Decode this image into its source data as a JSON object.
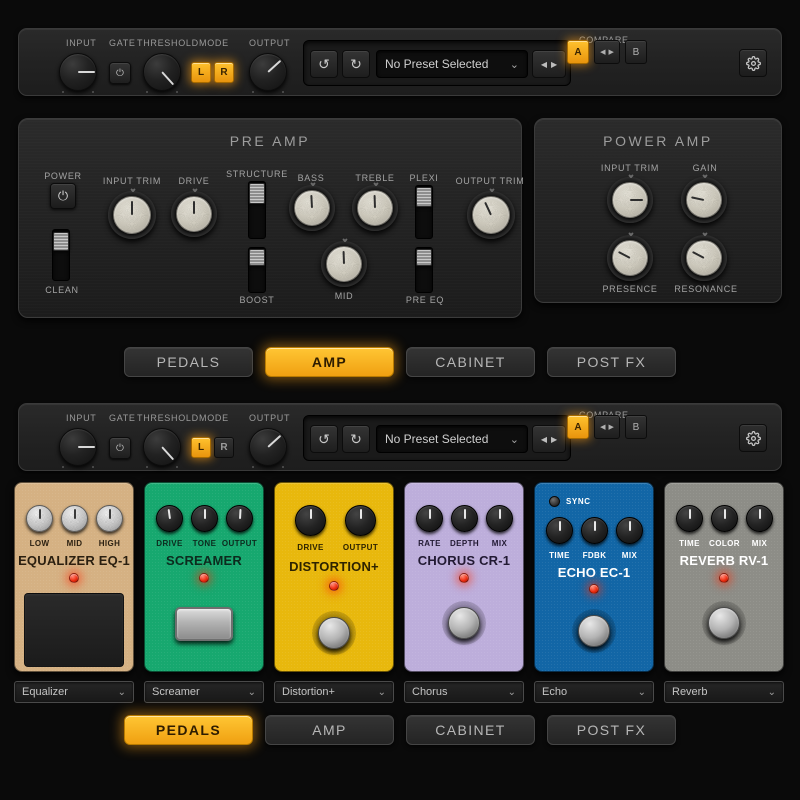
{
  "colors": {
    "accent": "#f0a011",
    "panel": "#242424",
    "background": "#0a0a0a",
    "led_red": "#ef2d10"
  },
  "toolbar_top": {
    "input_label": "INPUT",
    "gate_label": "GATE",
    "threshold_label": "THRESHOLD",
    "mode_label": "MODE",
    "output_label": "OUTPUT",
    "mode_l": "L",
    "mode_r": "R",
    "mode_l_active": true,
    "mode_r_active": true,
    "undo_icon": "undo-icon",
    "redo_icon": "redo-icon",
    "preset_value": "No Preset Selected",
    "preset_chevron": "⌄",
    "prev_icon": "◀",
    "next_icon": "▶",
    "compare_label": "COMPARE",
    "compare_a": "A",
    "compare_b": "B",
    "compare_a_active": true,
    "settings_icon": "gear-icon"
  },
  "toolbar_bottom": {
    "input_label": "INPUT",
    "gate_label": "GATE",
    "threshold_label": "THRESHOLD",
    "mode_label": "MODE",
    "output_label": "OUTPUT",
    "mode_l": "L",
    "mode_r": "R",
    "mode_l_active": true,
    "mode_r_active": false,
    "preset_value": "No Preset Selected",
    "preset_chevron": "⌄",
    "prev_icon": "◀",
    "next_icon": "▶",
    "compare_label": "COMPARE",
    "compare_a": "A",
    "compare_b": "B",
    "settings_icon": "gear-icon"
  },
  "pre_amp": {
    "title": "PRE AMP",
    "power_label": "POWER",
    "power_icon": "⏻",
    "clean_label": "CLEAN",
    "input_trim_label": "INPUT TRIM",
    "drive_label": "DRIVE",
    "structure_label": "STRUCTURE",
    "boost_label": "BOOST",
    "bass_label": "BASS",
    "treble_label": "TREBLE",
    "mid_label": "MID",
    "plexi_label": "PLEXI",
    "pre_eq_label": "PRE EQ",
    "output_trim_label": "OUTPUT TRIM"
  },
  "power_amp": {
    "title": "POWER AMP",
    "input_trim_label": "INPUT TRIM",
    "gain_label": "GAIN",
    "presence_label": "PRESENCE",
    "resonance_label": "RESONANCE"
  },
  "tabs_top": {
    "items": [
      {
        "label": "PEDALS",
        "active": false
      },
      {
        "label": "AMP",
        "active": true
      },
      {
        "label": "CABINET",
        "active": false
      },
      {
        "label": "POST FX",
        "active": false
      }
    ]
  },
  "tabs_bottom": {
    "items": [
      {
        "label": "PEDALS",
        "active": true
      },
      {
        "label": "AMP",
        "active": false
      },
      {
        "label": "CABINET",
        "active": false
      },
      {
        "label": "POST FX",
        "active": false
      }
    ]
  },
  "pedals": [
    {
      "name": "EQUALIZER EQ-1",
      "selector": "Equalizer",
      "body_color": "#d5b183",
      "text_color": "#2a1f10",
      "knob_style": "silver",
      "knobs": [
        {
          "label": "LOW",
          "angle": 0
        },
        {
          "label": "MID",
          "angle": 0
        },
        {
          "label": "HIGH",
          "angle": 0
        }
      ],
      "footswitch": "plate",
      "led_on": true,
      "sync": false
    },
    {
      "name": "SCREAMER",
      "selector": "Screamer",
      "body_color": "#17a86f",
      "text_color": "#0c2b1e",
      "knob_style": "dark",
      "knobs": [
        {
          "label": "DRIVE",
          "angle": -8
        },
        {
          "label": "TONE",
          "angle": 0
        },
        {
          "label": "OUTPUT",
          "angle": 3
        }
      ],
      "footswitch": "rect",
      "led_on": true,
      "sync": false
    },
    {
      "name": "DISTORTION+",
      "selector": "Distortion+",
      "body_color": "#e8b80d",
      "text_color": "#2d2300",
      "knob_style": "dark",
      "knobs": [
        {
          "label": "DRIVE",
          "angle": 0
        },
        {
          "label": "OUTPUT",
          "angle": 0
        }
      ],
      "footswitch": "round",
      "led_on": true,
      "sync": false
    },
    {
      "name": "CHORUS CR-1",
      "selector": "Chorus",
      "body_color": "#bdaedb",
      "text_color": "#221a33",
      "knob_style": "dark",
      "knobs": [
        {
          "label": "RATE",
          "angle": 0
        },
        {
          "label": "DEPTH",
          "angle": 0
        },
        {
          "label": "MIX",
          "angle": 0
        }
      ],
      "footswitch": "round",
      "led_on": true,
      "sync": false
    },
    {
      "name": "ECHO EC-1",
      "selector": "Echo",
      "body_color": "#1266a6",
      "text_color": "#ffffff",
      "knob_style": "dark",
      "knobs": [
        {
          "label": "TIME",
          "angle": 0
        },
        {
          "label": "FDBK",
          "angle": 0
        },
        {
          "label": "MIX",
          "angle": 0
        }
      ],
      "footswitch": "round",
      "led_on": true,
      "sync": true,
      "sync_label": "SYNC"
    },
    {
      "name": "REVERB RV-1",
      "selector": "Reverb",
      "body_color": "#8d8d87",
      "text_color": "#ffffff",
      "knob_style": "dark",
      "knobs": [
        {
          "label": "TIME",
          "angle": 0
        },
        {
          "label": "COLOR",
          "angle": 0
        },
        {
          "label": "MIX",
          "angle": 0
        }
      ],
      "footswitch": "round",
      "led_on": true,
      "sync": false
    }
  ],
  "selector_chevron": "⌄"
}
